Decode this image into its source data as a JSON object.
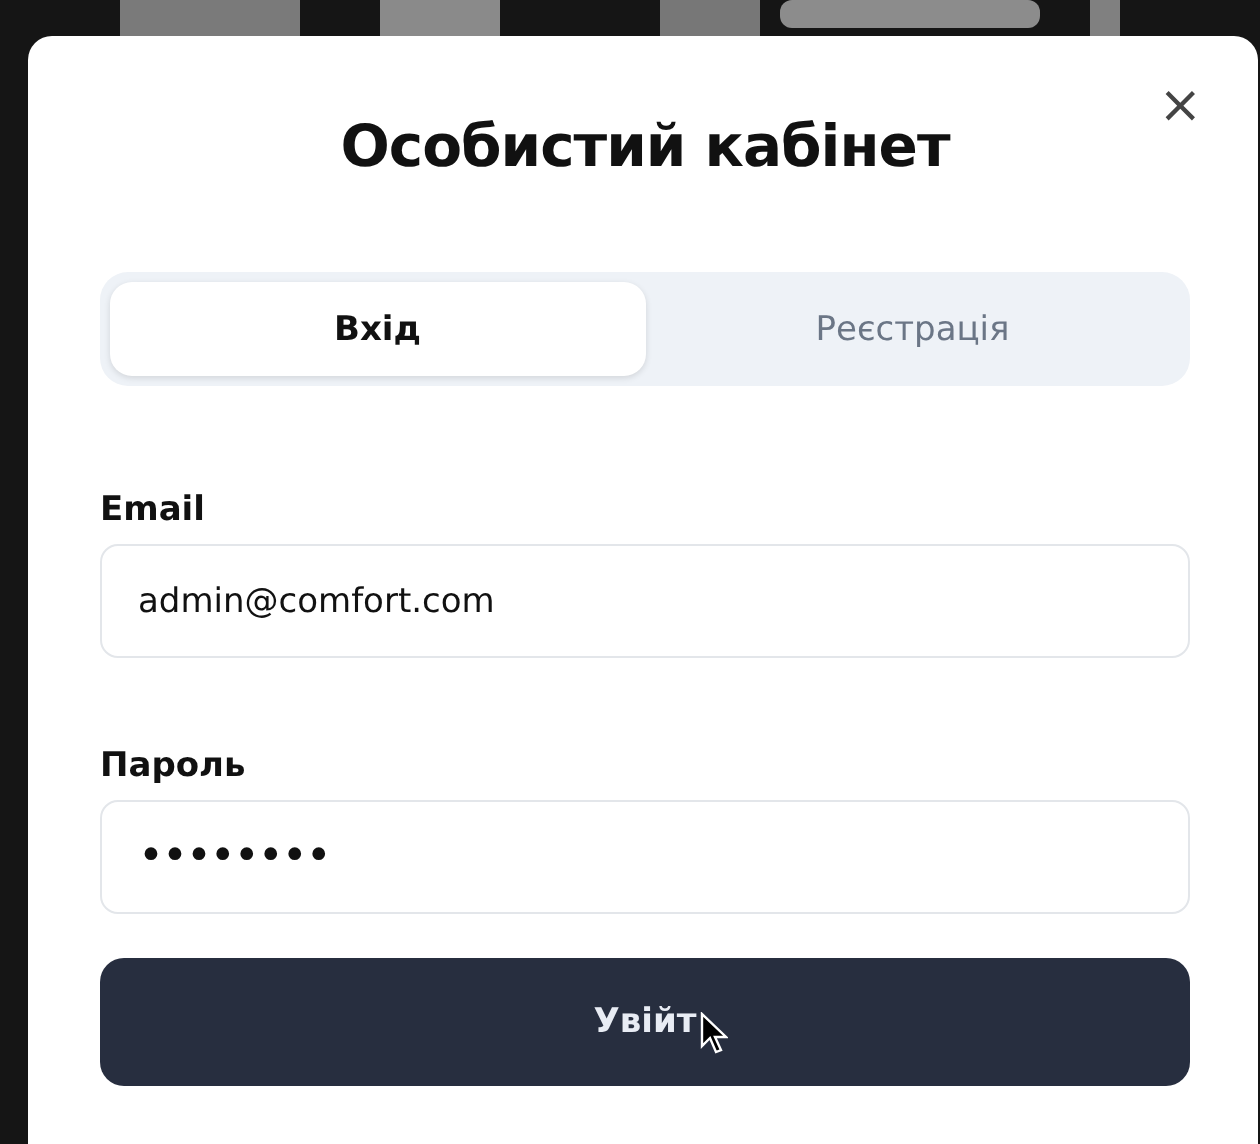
{
  "dialog": {
    "title": "Особистий кабінет",
    "close": "×"
  },
  "tabs": [
    {
      "label": "Вхід",
      "selected": true
    },
    {
      "label": "Реєстрація",
      "selected": false
    }
  ],
  "fields": [
    {
      "label": "Email",
      "value": "admin@comfort.com",
      "kind": "text"
    },
    {
      "label": "Пароль",
      "value": "••••••••",
      "kind": "password"
    }
  ],
  "submit": {
    "label": "Увійт"
  }
}
